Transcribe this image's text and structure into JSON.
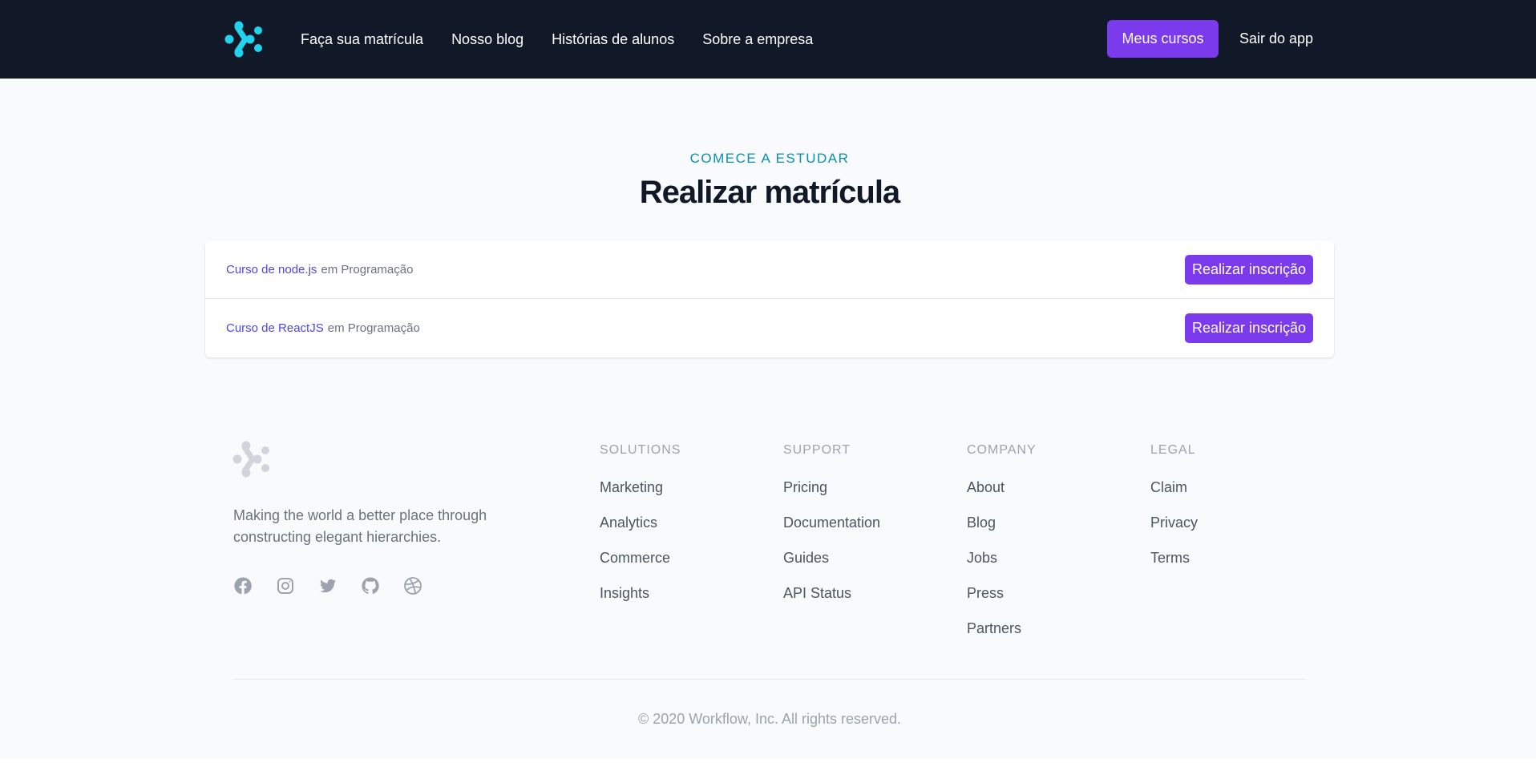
{
  "nav": {
    "links": [
      {
        "label": "Faça sua matrícula"
      },
      {
        "label": "Nosso blog"
      },
      {
        "label": "Histórias de alunos"
      },
      {
        "label": "Sobre a empresa"
      }
    ],
    "primary_button": "Meus cursos",
    "logout": "Sair do app",
    "logo_icon": "workflow-logo-icon"
  },
  "hero": {
    "eyebrow": "COMECE A ESTUDAR",
    "title": "Realizar matrícula"
  },
  "courses": [
    {
      "name": "Curso de node.js",
      "category": "em Programação",
      "button": "Realizar inscrição"
    },
    {
      "name": "Curso de ReactJS",
      "category": "em Programação",
      "button": "Realizar inscrição"
    }
  ],
  "footer": {
    "tagline": "Making the world a better place through constructing elegant hierarchies.",
    "socials": [
      "facebook-icon",
      "instagram-icon",
      "twitter-icon",
      "github-icon",
      "dribbble-icon"
    ],
    "columns": [
      {
        "title": "SOLUTIONS",
        "items": [
          "Marketing",
          "Analytics",
          "Commerce",
          "Insights"
        ]
      },
      {
        "title": "SUPPORT",
        "items": [
          "Pricing",
          "Documentation",
          "Guides",
          "API Status"
        ]
      },
      {
        "title": "COMPANY",
        "items": [
          "About",
          "Blog",
          "Jobs",
          "Press",
          "Partners"
        ]
      },
      {
        "title": "LEGAL",
        "items": [
          "Claim",
          "Privacy",
          "Terms"
        ]
      }
    ],
    "copyright": "© 2020 Workflow, Inc. All rights reserved."
  },
  "colors": {
    "nav_bg": "#111827",
    "accent": "#7c3aed",
    "eyebrow": "#0891b2",
    "link": "#4f46e5",
    "logo_cyan": "#22d3ee"
  }
}
